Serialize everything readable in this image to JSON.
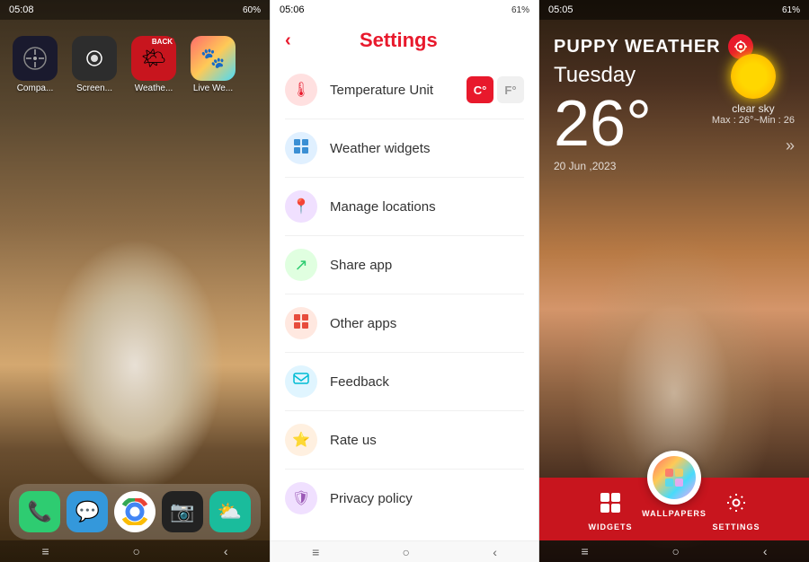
{
  "phone1": {
    "status_time": "05:08",
    "status_battery": "60%",
    "apps": [
      {
        "name": "Compass",
        "label": "Compa...",
        "bg": "#1a1a2e",
        "icon": "🧭"
      },
      {
        "name": "Screenshot",
        "label": "Screen...",
        "bg": "#2d2d2d",
        "icon": "📷"
      },
      {
        "name": "Weather",
        "label": "Weathe...",
        "bg": "#c8151e",
        "icon": "🌤"
      },
      {
        "name": "Live Wallpaper",
        "label": "Live We...",
        "bg": "#4a90d9",
        "icon": "🐾"
      }
    ],
    "dock": [
      {
        "name": "Phone",
        "icon": "📞",
        "bg": "#2ecc71"
      },
      {
        "name": "Messages",
        "icon": "💬",
        "bg": "#3498db"
      },
      {
        "name": "Chrome",
        "icon": "🌐",
        "bg": "#f39c12"
      },
      {
        "name": "Camera",
        "icon": "📷",
        "bg": "#9b59b6"
      },
      {
        "name": "Weather2",
        "icon": "⛅",
        "bg": "#1abc9c"
      }
    ],
    "nav": [
      "≡",
      "○",
      "‹"
    ]
  },
  "phone2": {
    "status_time": "05:06",
    "status_battery": "61%",
    "title": "Settings",
    "back_label": "‹",
    "items": [
      {
        "label": "Temperature  Unit",
        "icon": "🌡",
        "icon_bg": "#ffe0e0",
        "has_toggle": true
      },
      {
        "label": "Weather widgets",
        "icon": "⊞",
        "icon_bg": "#e0f0ff"
      },
      {
        "label": "Manage locations",
        "icon": "📍",
        "icon_bg": "#f0e0ff"
      },
      {
        "label": "Share app",
        "icon": "↗",
        "icon_bg": "#e0ffe0"
      },
      {
        "label": "Other apps",
        "icon": "⊞",
        "icon_bg": "#ffe8e0"
      },
      {
        "label": "Feedback",
        "icon": "💬",
        "icon_bg": "#e0f5ff"
      },
      {
        "label": "Rate us",
        "icon": "⭐",
        "icon_bg": "#fff0e0"
      },
      {
        "label": "Privacy policy",
        "icon": "🛡",
        "icon_bg": "#f0e0ff"
      }
    ],
    "temp_c": "C°",
    "temp_f": "F°",
    "nav": [
      "≡",
      "○",
      "‹"
    ]
  },
  "phone3": {
    "status_time": "05:05",
    "status_battery": "61%",
    "app_name": "PUPPY WEATHER",
    "day": "Tuesday",
    "temperature": "26°",
    "sky": "clear sky",
    "max_min": "Max : 26°~Min : 26",
    "date": "20 Jun ,2023",
    "bottom_buttons": [
      {
        "label": "WIDGETS",
        "icon": "⊞"
      },
      {
        "label": "WALLPAPERS",
        "icon": "🖼"
      },
      {
        "label": "SETTINGS",
        "icon": "⚙"
      }
    ],
    "nav": [
      "≡",
      "○",
      "‹"
    ]
  }
}
